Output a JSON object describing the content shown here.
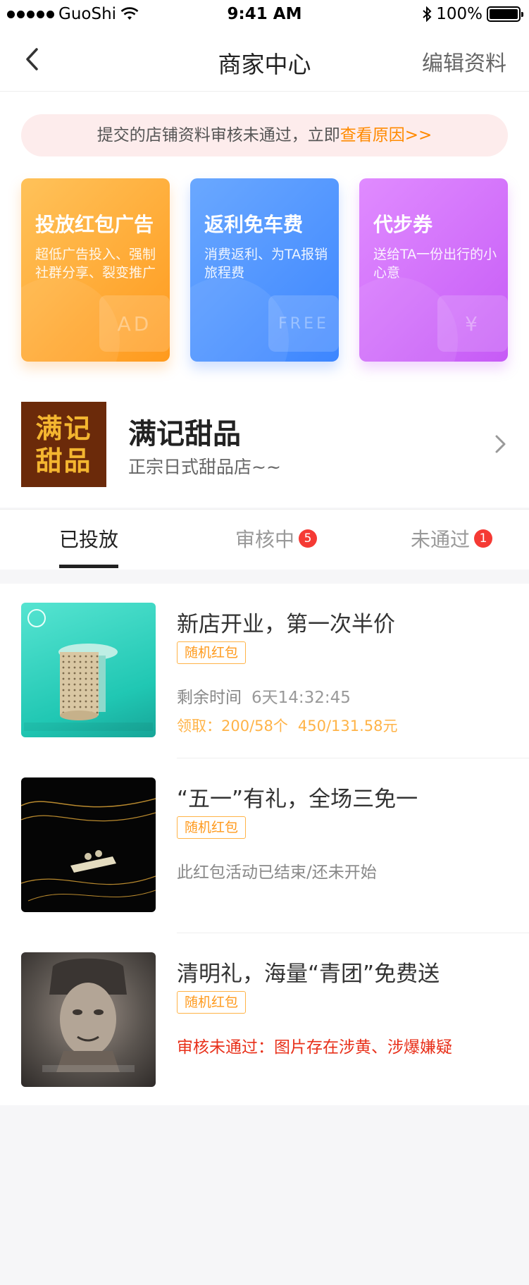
{
  "status_bar": {
    "carrier": "GuoShi",
    "time": "9:41 AM",
    "battery": "100%"
  },
  "nav": {
    "title": "商家中心",
    "edit_label": "编辑资料"
  },
  "notice": {
    "text": "提交的店铺资料审核未通过，立即",
    "link": "查看原因>>"
  },
  "cards": [
    {
      "title": "投放红包广告",
      "desc": "超低广告投入、强制社群分享、裂变推广",
      "deco": "AD"
    },
    {
      "title": "返利免车费",
      "desc": "消费返利、为TA报销旅程费",
      "deco": "FREE"
    },
    {
      "title": "代步券",
      "desc": "送给TA一份出行的小心意",
      "deco": "¥"
    }
  ],
  "shop": {
    "logo_line1": "满记",
    "logo_line2": "甜品",
    "name": "满记甜品",
    "desc": "正宗日式甜品店~~"
  },
  "tabs": [
    {
      "label": "已投放",
      "active": true
    },
    {
      "label": "审核中",
      "badge": "5"
    },
    {
      "label": "未通过",
      "badge": "1"
    }
  ],
  "items": [
    {
      "title": "新店开业，第一次半价",
      "tag": "随机红包",
      "remain_label": "剩余时间",
      "remain_value": "6天14:32:45",
      "claim_label": "领取：200/58个",
      "claim_value": "450/131.58元"
    },
    {
      "title": "“五一”有礼，全场三免一",
      "tag": "随机红包",
      "status": "此红包活动已结束/还未开始"
    },
    {
      "title": "清明礼，海量“青团”免费送",
      "tag": "随机红包",
      "status": "审核未通过：图片存在涉黄、涉爆嫌疑"
    }
  ],
  "colors": {
    "accent_orange": "#ff9a1d",
    "reject_red": "#e8301a",
    "badge_red": "#f53a34"
  }
}
